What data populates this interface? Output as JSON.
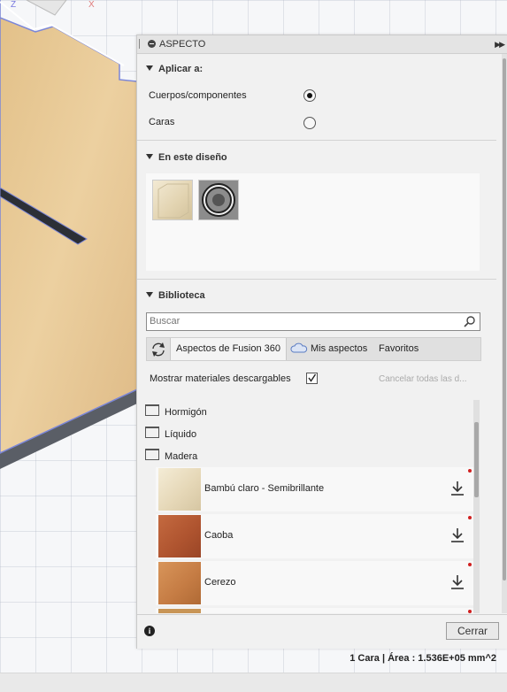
{
  "panel": {
    "title": "ASPECTO",
    "apply_section": {
      "title": "Aplicar a:",
      "options": [
        {
          "label": "Cuerpos/componentes",
          "selected": true
        },
        {
          "label": "Caras",
          "selected": false
        }
      ]
    },
    "design_section": {
      "title": "En este diseño",
      "thumbnails": [
        "wood-cube-icon",
        "chrome-ring-icon"
      ]
    },
    "library_section": {
      "title": "Biblioteca",
      "search": {
        "placeholder": "Buscar",
        "value": ""
      },
      "tabs": [
        {
          "label": "Aspectos de Fusion 360",
          "active": true
        },
        {
          "label": "Mis aspectos",
          "active": false
        },
        {
          "label": "Favoritos",
          "active": false
        }
      ],
      "show_downloadable_label": "Mostrar materiales descargables",
      "show_downloadable_checked": true,
      "cancel_all_label": "Cancelar todas las d...",
      "folders": [
        "Hormigón",
        "Líquido",
        "Madera"
      ],
      "materials": [
        {
          "label": "Bambú claro - Semibrillante",
          "color": "#e9dcc0"
        },
        {
          "label": "Caoba",
          "color": "#b5582f"
        },
        {
          "label": "Cerezo",
          "color": "#c9854b"
        },
        {
          "label": "",
          "color": "#c89556"
        }
      ]
    },
    "close_label": "Cerrar"
  },
  "status": {
    "text": "1 Cara | Área : 1.536E+05 mm^2"
  },
  "colors": {
    "wood_top": "#e6c590",
    "wood_edge": "#555b66",
    "selection": "#7b86d8"
  }
}
